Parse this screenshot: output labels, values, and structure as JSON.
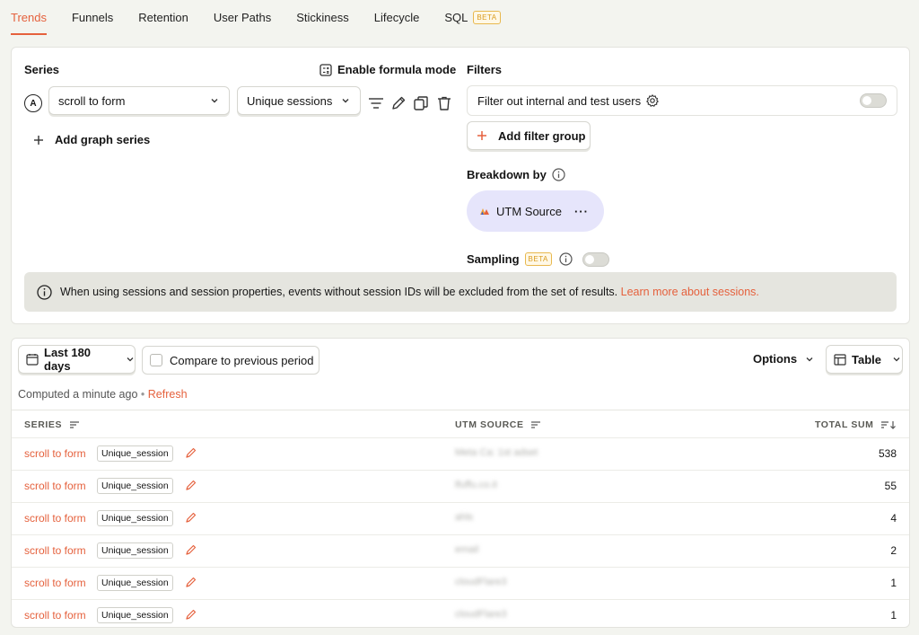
{
  "tabs": [
    {
      "label": "Trends"
    },
    {
      "label": "Funnels"
    },
    {
      "label": "Retention"
    },
    {
      "label": "User Paths"
    },
    {
      "label": "Stickiness"
    },
    {
      "label": "Lifecycle"
    },
    {
      "label": "SQL",
      "badge": "BETA"
    }
  ],
  "series_panel": {
    "title": "Series",
    "formula_label": "Enable formula mode",
    "series_letter": "A",
    "event_value": "scroll to form",
    "math_value": "Unique sessions",
    "add_series_label": "Add graph series"
  },
  "filters_panel": {
    "title": "Filters",
    "internal_filter_label": "Filter out internal and test users",
    "add_filter_group_label": "Add filter group",
    "breakdown_title": "Breakdown by",
    "breakdown_value": "UTM Source",
    "breakdown_more": "···",
    "sampling_label": "Sampling",
    "sampling_badge": "BETA"
  },
  "notice": {
    "text": "When using sessions and session properties, events without session IDs will be excluded from the set of results.",
    "link": "Learn more about sessions."
  },
  "results": {
    "date_range": "Last 180 days",
    "compare_label": "Compare to previous period",
    "options_label": "Options",
    "view_label": "Table",
    "computed_text": "Computed a minute ago",
    "refresh_label": "Refresh",
    "columns": [
      "SERIES",
      "UTM SOURCE",
      "TOTAL SUM"
    ],
    "rows": [
      {
        "series": "scroll to form",
        "tag": "Unique_session",
        "utm": "Meta Ca: 1st adset",
        "total": "538"
      },
      {
        "series": "scroll to form",
        "tag": "Unique_session",
        "utm": "lfuffu.co.it",
        "total": "55"
      },
      {
        "series": "scroll to form",
        "tag": "Unique_session",
        "utm": "ahls",
        "total": "4"
      },
      {
        "series": "scroll to form",
        "tag": "Unique_session",
        "utm": "email",
        "total": "2"
      },
      {
        "series": "scroll to form",
        "tag": "Unique_session",
        "utm": "cloudFlare3",
        "total": "1"
      },
      {
        "series": "scroll to form",
        "tag": "Unique_session",
        "utm": "cloudFlare3",
        "total": "1"
      }
    ]
  },
  "colors": {
    "accent": "#e5613d",
    "breakdown_pill": "#e6e5fb",
    "beta": "#d99b1e"
  }
}
